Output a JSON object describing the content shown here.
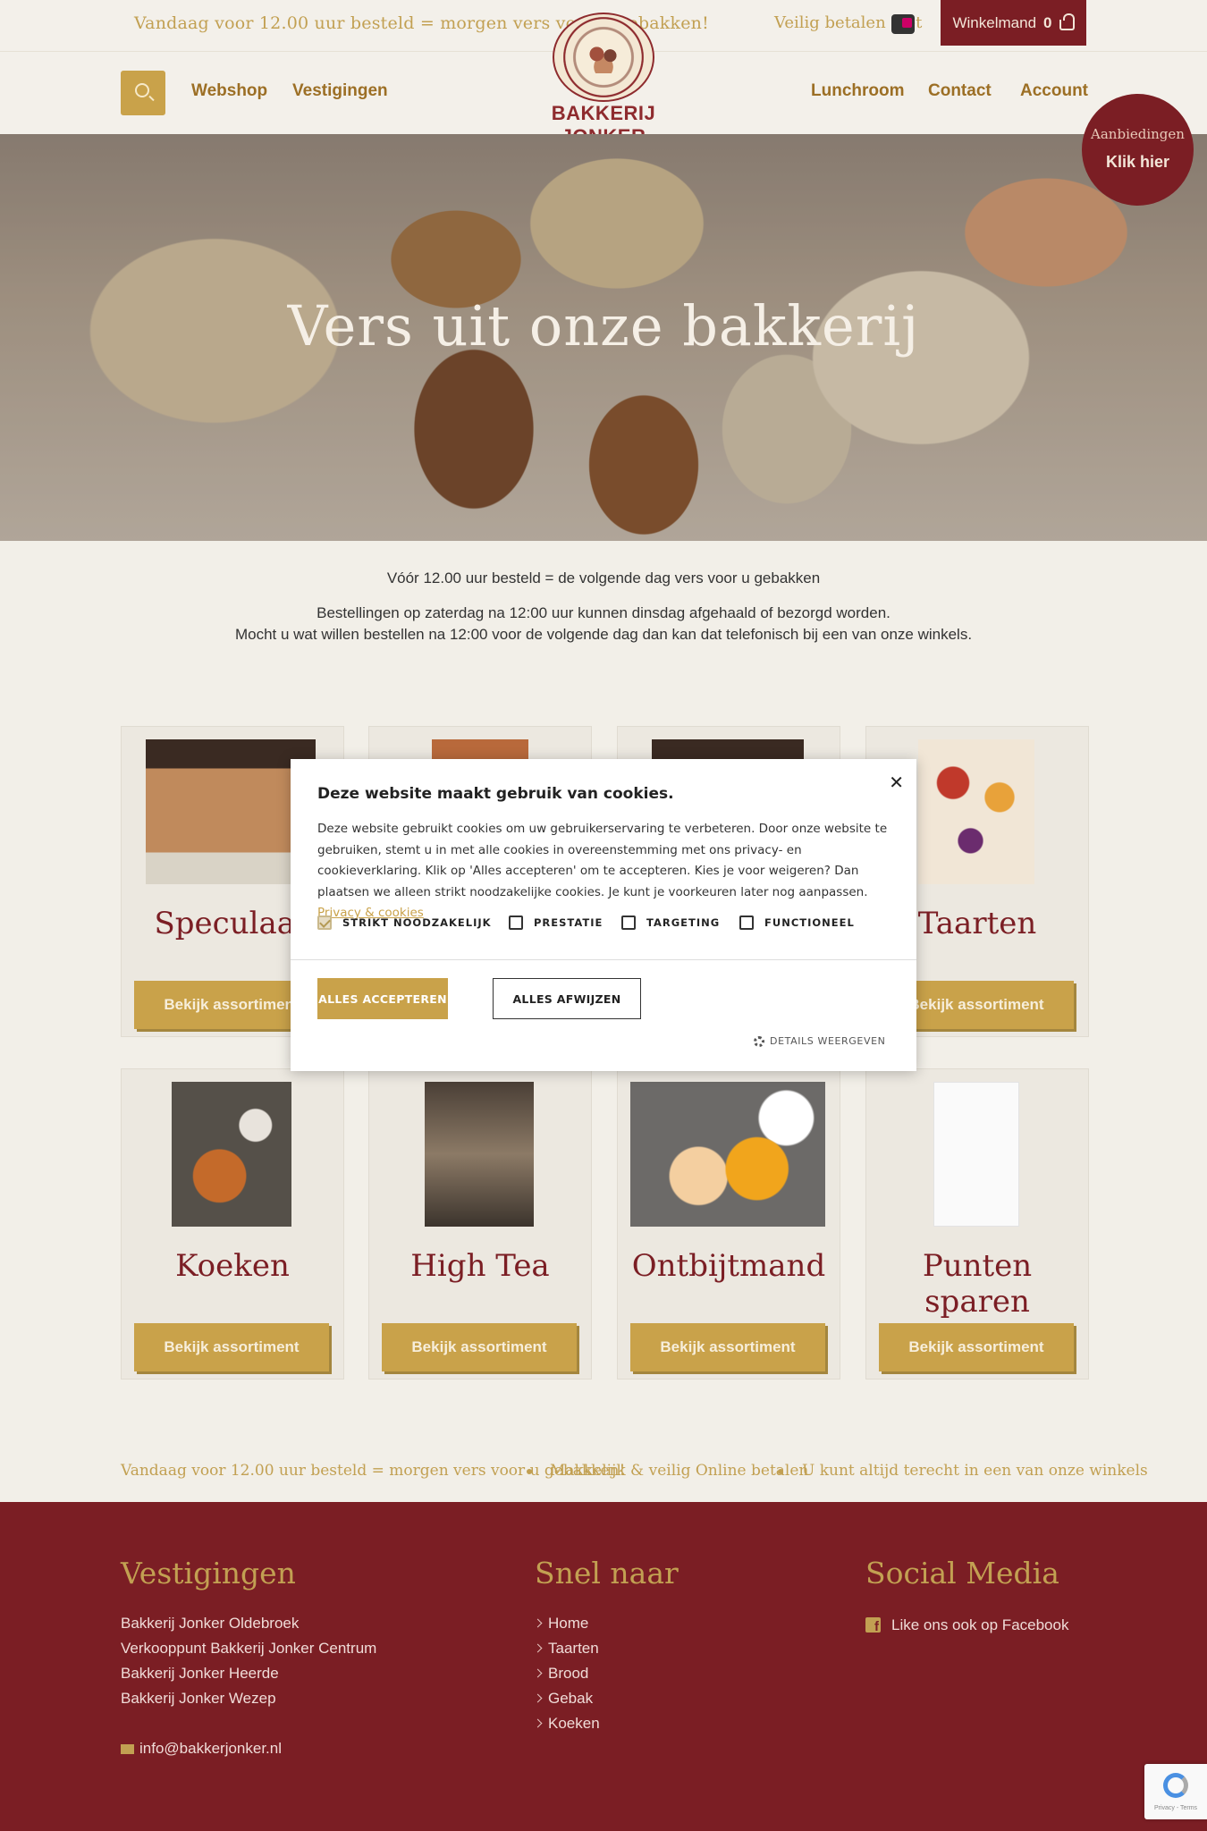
{
  "topbar": {
    "promo": "Vandaag voor 12.00 uur besteld = morgen vers voor u gebakken!",
    "pay": "Veilig betalen met",
    "cart_label": "Winkelmand",
    "cart_count": "0"
  },
  "nav": {
    "left": [
      "Webshop",
      "Vestigingen"
    ],
    "right": [
      "Lunchroom",
      "Contact",
      "Account"
    ],
    "logo_text": "BAKKERIJ JONKER"
  },
  "promo_circle": {
    "line1": "Aanbiedingen",
    "line2": "Klik hier"
  },
  "hero": {
    "title": "Vers uit onze bakkerij"
  },
  "info": {
    "line1": "Vóór 12.00 uur besteld = de volgende dag vers voor u gebakken",
    "line2": "Bestellingen op zaterdag na 12:00 uur kunnen dinsdag afgehaald of bezorgd worden.",
    "line3": "Mocht u wat willen bestellen na 12:00 voor de volgende dag dan kan dat telefonisch bij een van onze winkels."
  },
  "products": [
    {
      "name": "Speculaas",
      "button": "Bekijk assortiment"
    },
    {
      "name": "",
      "button": ""
    },
    {
      "name": "",
      "button": ""
    },
    {
      "name": "Taarten",
      "button": "Bekijk assortiment"
    },
    {
      "name": "Koeken",
      "button": "Bekijk assortiment"
    },
    {
      "name": "High Tea",
      "button": "Bekijk assortiment"
    },
    {
      "name": "Ontbijtmand",
      "button": "Bekijk assortiment"
    },
    {
      "name": "Punten sparen",
      "button": "Bekijk assortiment"
    }
  ],
  "ticker": [
    "Vandaag voor 12.00 uur besteld = morgen vers voor u gebakken!",
    "Makkelijk & veilig Online betalen",
    "U kunt altijd terecht in een van onze winkels"
  ],
  "footer": {
    "vestigingen_title": "Vestigingen",
    "vestigingen": [
      "Bakkerij Jonker Oldebroek",
      "Verkooppunt Bakkerij Jonker Centrum",
      "Bakkerij Jonker Heerde",
      "Bakkerij Jonker Wezep"
    ],
    "email": "info@bakkerjonker.nl",
    "snel_title": "Snel naar",
    "snel": [
      "Home",
      "Taarten",
      "Brood",
      "Gebak",
      "Koeken"
    ],
    "social_title": "Social Media",
    "facebook": "Like ons ook op Facebook"
  },
  "recaptcha": {
    "text": "Privacy - Terms"
  },
  "cookie": {
    "title": "Deze website maakt gebruik van cookies.",
    "body": "Deze website gebruikt cookies om uw gebruikerservaring te verbeteren. Door onze website te gebruiken, stemt u in met alle cookies in overeenstemming met ons privacy- en cookieverklaring. Klik op 'Alles accepteren' om te accepteren. Kies je voor weigeren? Dan plaatsen we alleen strikt noodzakelijke cookies. Je kunt je voorkeuren later nog aanpassen.",
    "link": "Privacy & cookies",
    "checkboxes": [
      {
        "label": "STRIKT NOODZAKELIJK",
        "checked": true
      },
      {
        "label": "PRESTATIE",
        "checked": false
      },
      {
        "label": "TARGETING",
        "checked": false
      },
      {
        "label": "FUNCTIONEEL",
        "checked": false
      }
    ],
    "accept": "ALLES ACCEPTEREN",
    "reject": "ALLES AFWIJZEN",
    "details": "DETAILS WEERGEVEN",
    "close": "✕"
  },
  "colors": {
    "brand_red": "#7b1e24",
    "brand_gold": "#c9a24a",
    "background": "#f2efe8"
  }
}
